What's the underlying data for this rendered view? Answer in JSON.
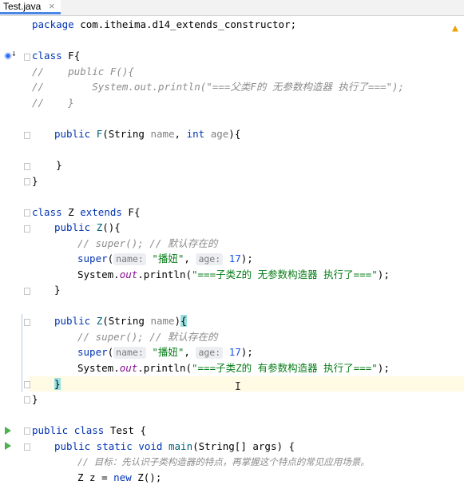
{
  "tab": {
    "title": "Test.java",
    "close_glyph": "×",
    "accent_color": "#4a86e8"
  },
  "editor": {
    "language": "java",
    "status_icon": "warning-icon",
    "lines": {
      "l1_package": "package",
      "l1_pkgname": " com.itheima.d14_extends_constructor;",
      "l3_class": "class",
      "l3_rest": " F{",
      "l4": "//    public F(){",
      "l5": "//        System.out.println(\"===父类F的 无参数构造器 执行了===\");",
      "l6": "//    }",
      "l8_public": "public ",
      "l8_fn": "F",
      "l8_a": "(String ",
      "l8_name": "name",
      "l8_b": ", ",
      "l8_int": "int",
      "l8_c": " ",
      "l8_age": "age",
      "l8_d": "){",
      "l10": "    }",
      "l11": "}",
      "l13_class": "class",
      "l13_z": " Z ",
      "l13_extends": "extends",
      "l13_rest": " F{",
      "l14_public": "public ",
      "l14_fn": "Z",
      "l14_rest": "(){",
      "l15": "// super(); // 默认存在的",
      "l16_super": "super",
      "l16_open": "(",
      "l16_hint1": "name:",
      "l16_str": "\"播妞\"",
      "l16_comma": ", ",
      "l16_hint2": "age:",
      "l16_num": "17",
      "l16_close": ");",
      "l17_sys": "System.",
      "l17_out": "out",
      "l17_print": ".println(",
      "l17_str": "\"===子类Z的 无参数构造器 执行了===\"",
      "l17_end": ");",
      "l18": "}",
      "l20_public": "public ",
      "l20_fn": "Z",
      "l20_a": "(String ",
      "l20_name": "name",
      "l20_b": ")",
      "l20_brace": "{",
      "l21": "// super(); // 默认存在的",
      "l22_super": "super",
      "l22_open": "(",
      "l22_hint1": "name:",
      "l22_str": "\"播妞\"",
      "l22_comma": ", ",
      "l22_hint2": "age:",
      "l22_num": "17",
      "l22_close": ");",
      "l23_sys": "System.",
      "l23_out": "out",
      "l23_print": ".println(",
      "l23_str": "\"===子类Z的 有参数构造器 执行了===\"",
      "l23_end": ");",
      "l24_brace": "}",
      "l25": "}",
      "l27_public": "public ",
      "l27_class": "class",
      "l27_rest": " Test {",
      "l28_kw": "public static void ",
      "l28_fn": "main",
      "l28_rest": "(String[] args) {",
      "l29": "// 目标：先认识子类构造器的特点，再掌握这个特点的常见应用场景。",
      "l30_a": "Z z = ",
      "l30_new": "new",
      "l30_b": " Z();"
    }
  }
}
